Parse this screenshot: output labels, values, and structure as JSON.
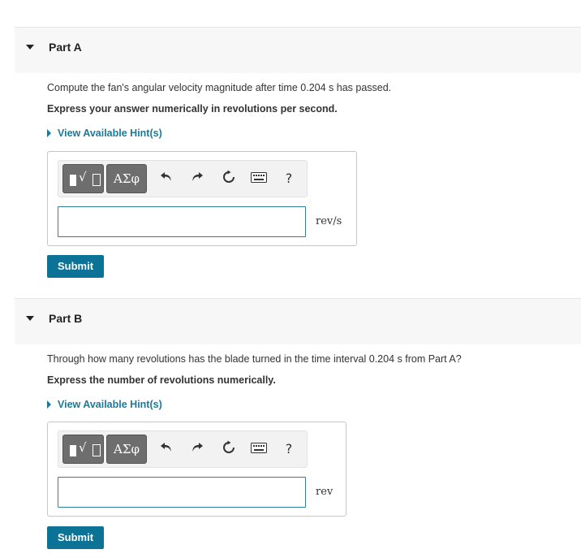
{
  "parts": [
    {
      "title": "Part A",
      "question": "Compute the fan's angular velocity magnitude after time 0.204 s has passed.",
      "instruction": "Express your answer numerically in revolutions per second.",
      "hint": "View Available Hint(s)",
      "toolbar": {
        "symbols_label": "ΑΣφ",
        "undo_icon": "undo-icon",
        "redo_icon": "redo-icon",
        "reset_icon": "reset-icon",
        "keyboard_icon": "keyboard-icon",
        "help_label": "?"
      },
      "answer_value": "",
      "unit": "rev/s",
      "submit_label": "Submit"
    },
    {
      "title": "Part B",
      "question": "Through how many revolutions has the blade turned in the time interval 0.204 s from Part A?",
      "instruction": "Express the number of revolutions numerically.",
      "hint": "View Available Hint(s)",
      "toolbar": {
        "symbols_label": "ΑΣφ",
        "undo_icon": "undo-icon",
        "redo_icon": "redo-icon",
        "reset_icon": "reset-icon",
        "keyboard_icon": "keyboard-icon",
        "help_label": "?"
      },
      "answer_value": "",
      "unit": "rev",
      "submit_label": "Submit"
    }
  ],
  "colors": {
    "accent": "#0d7396",
    "hint": "#1a7a9c",
    "header_bg": "#f7f7f7",
    "input_border": "#2f7fa5"
  }
}
